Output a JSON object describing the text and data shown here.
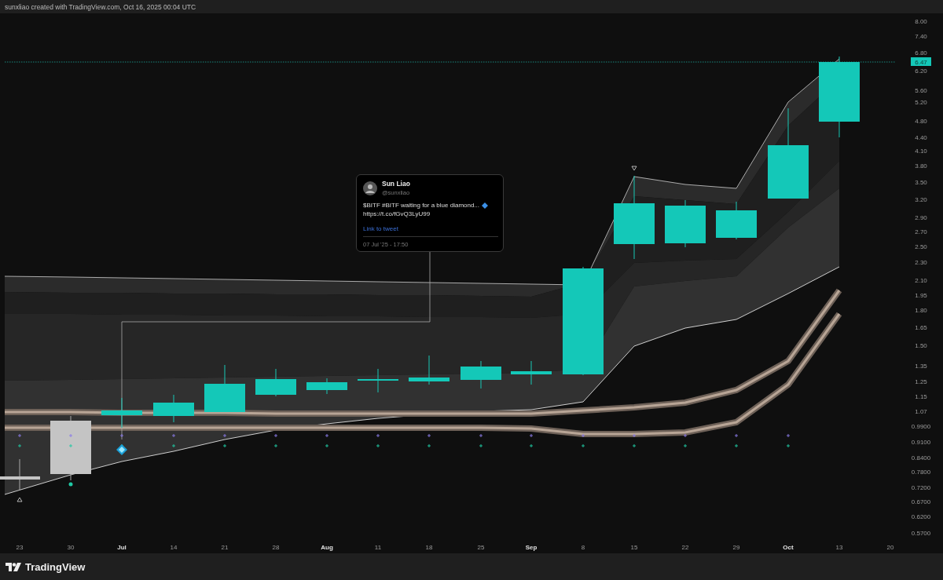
{
  "header": {
    "caption": "sunxliao created with TradingView.com, Oct 16, 2025 00:04 UTC"
  },
  "tweet": {
    "author": "Sun Liao",
    "handle": "@sunxliao",
    "text": "$BITF #BITF waiting for a blue diamond...",
    "url": "https://t.co/fGvQ3LyU99",
    "link": "Link to tweet",
    "time": "07 Jul '25 - 17:50"
  },
  "price_axis": [
    "8.00",
    "7.40",
    "6.80",
    "6.20",
    "5.60",
    "5.20",
    "4.80",
    "4.40",
    "4.10",
    "3.80",
    "3.50",
    "3.20",
    "2.90",
    "2.70",
    "2.50",
    "2.30",
    "2.10",
    "1.95",
    "1.80",
    "1.65",
    "1.50",
    "1.35",
    "1.25",
    "1.15",
    "1.07",
    "0.9900",
    "0.9100",
    "0.8400",
    "0.7800",
    "0.7200",
    "0.6700",
    "0.6200",
    "0.5700"
  ],
  "current_price": "6.47",
  "time_axis": [
    {
      "label": "23",
      "kind": "day"
    },
    {
      "label": "30",
      "kind": "day"
    },
    {
      "label": "Jul",
      "kind": "month"
    },
    {
      "label": "14",
      "kind": "day"
    },
    {
      "label": "21",
      "kind": "day"
    },
    {
      "label": "28",
      "kind": "day"
    },
    {
      "label": "Aug",
      "kind": "month"
    },
    {
      "label": "11",
      "kind": "day"
    },
    {
      "label": "18",
      "kind": "day"
    },
    {
      "label": "25",
      "kind": "day"
    },
    {
      "label": "Sep",
      "kind": "month"
    },
    {
      "label": "8",
      "kind": "day"
    },
    {
      "label": "15",
      "kind": "day"
    },
    {
      "label": "22",
      "kind": "day"
    },
    {
      "label": "29",
      "kind": "day"
    },
    {
      "label": "Oct",
      "kind": "month"
    },
    {
      "label": "13",
      "kind": "day"
    },
    {
      "label": "20",
      "kind": "day"
    }
  ],
  "brand": "TradingView"
}
